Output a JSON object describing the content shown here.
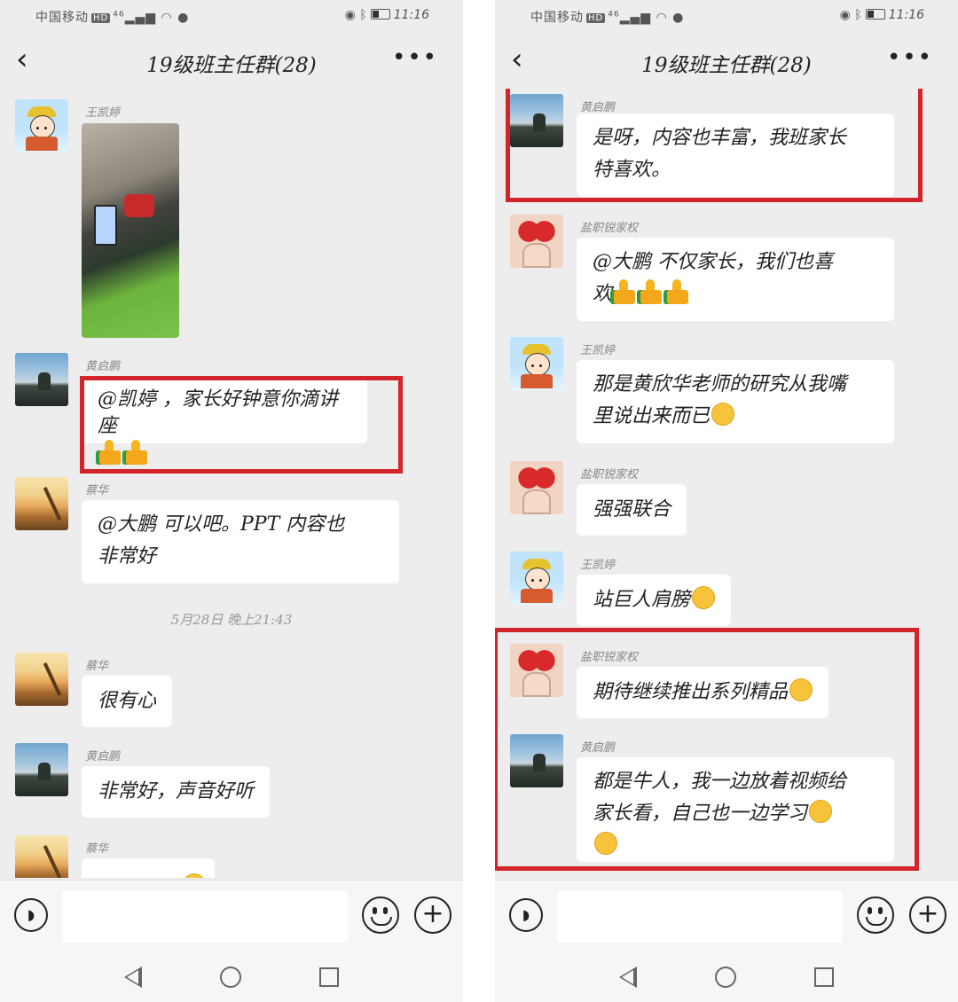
{
  "status": {
    "carrier": "中国移动",
    "hd": "HD",
    "net": "46",
    "time": "11:16"
  },
  "left": {
    "title": "19级班主任群(28)",
    "messages": [
      {
        "sender": "王凯婷"
      },
      {
        "sender": "黄启鹏",
        "text": "@凯婷 ，家长好钟意你滴讲座"
      },
      {
        "sender": "蔡华",
        "line1": "@大鹏  可以吧。PPT 内容也",
        "line2": "非常好"
      },
      {
        "sender": "蔡华",
        "text": "很有心"
      },
      {
        "sender": "黄启鹏",
        "text": "非常好，声音好听"
      },
      {
        "sender": "蔡华"
      }
    ],
    "timestamp": "5月28日 晚上21:43"
  },
  "right": {
    "title": "19级班主任群(28)",
    "messages": [
      {
        "sender": "黄启鹏",
        "line1": "是呀，内容也丰富，我班家长",
        "line2": "特喜欢。"
      },
      {
        "sender": "盐职锐家权",
        "line1": "@大鹏  不仅家长，我们也喜",
        "line2": "欢"
      },
      {
        "sender": "王凯婷",
        "line1": "那是黄欣华老师的研究从我嘴",
        "line2": "里说出来而已"
      },
      {
        "sender": "盐职锐家权",
        "text": "强强联合"
      },
      {
        "sender": "王凯婷",
        "text": "站巨人肩膀"
      },
      {
        "sender": "盐职锐家权",
        "text": "期待继续推出系列精品"
      },
      {
        "sender": "黄启鹏",
        "line1": "都是牛人，我一边放着视频给",
        "line2": "家长看，自己也一边学习"
      }
    ]
  },
  "icons": {
    "back": "chevron-left-icon",
    "more": "more-dots-icon",
    "voice": "voice-icon",
    "emoji": "emoji-icon",
    "plus": "plus-icon"
  },
  "colors": {
    "highlight": "#d4242b",
    "chat_bg": "#ededed",
    "bubble": "#ffffff"
  }
}
